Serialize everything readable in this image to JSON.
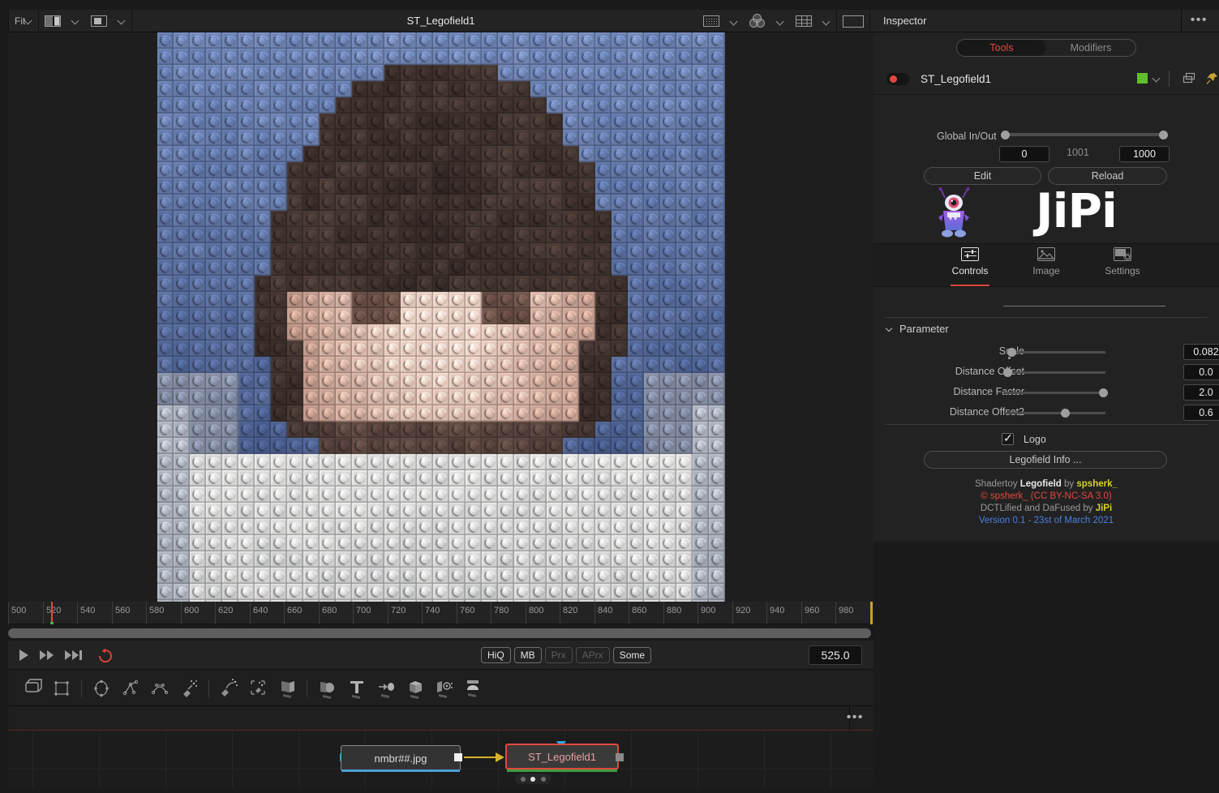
{
  "viewer": {
    "title": "ST_Legofield1",
    "toolbar": {
      "fit_label": "Fit",
      "split_view_icon": "split-view-icon",
      "inset_view_icon": "inset-view-icon",
      "roi_icon": "region-of-interest-icon",
      "color_icon": "color-channels-icon",
      "grid_icon": "grid-overlay-icon",
      "frame_icon": "frame-aspect-icon",
      "options_icon": "more-options-icon"
    }
  },
  "timeline": {
    "ticks": [
      500,
      520,
      540,
      560,
      580,
      600,
      620,
      640,
      660,
      680,
      700,
      720,
      740,
      760,
      780,
      800,
      820,
      840,
      860,
      880,
      900,
      920,
      940,
      960,
      980
    ],
    "range_start": 500,
    "range_end": 1000,
    "playhead_frame": 525
  },
  "transport": {
    "play_icon": "play-icon",
    "fast_forward_icon": "fast-forward-icon",
    "skip_end_icon": "skip-to-end-icon",
    "loop_icon": "loop-icon",
    "quality_buttons": [
      {
        "label": "HiQ",
        "active": true
      },
      {
        "label": "MB",
        "active": true
      },
      {
        "label": "Prx",
        "active": false
      },
      {
        "label": "APrx",
        "active": false
      },
      {
        "label": "Some",
        "active": true
      }
    ],
    "current_frame": "525.0"
  },
  "node_tools": [
    {
      "name": "transform-tool-icon"
    },
    {
      "name": "rectangle-mask-icon"
    },
    {
      "name": "ellipse-mask-icon"
    },
    {
      "name": "polygon-mask-icon"
    },
    {
      "name": "bspline-mask-icon"
    },
    {
      "name": "paint-tool-icon"
    },
    {
      "name": "paint-stroke-icon"
    },
    {
      "name": "paint-select-icon"
    },
    {
      "name": "merge3d-icon"
    },
    {
      "name": "shape3d-icon"
    },
    {
      "name": "text3d-icon"
    },
    {
      "name": "replicate3d-icon"
    },
    {
      "name": "cube3d-icon"
    },
    {
      "name": "camera3d-icon"
    },
    {
      "name": "renderer3d-icon"
    }
  ],
  "node_graph": {
    "source_node": "nmbr##.jpg",
    "target_node": "ST_Legofield1"
  },
  "inspector": {
    "panel_title": "Inspector",
    "more_icon": "more-options-icon",
    "segments": [
      {
        "label": "Tools",
        "active": true
      },
      {
        "label": "Modifiers",
        "active": false
      }
    ],
    "node": {
      "name": "ST_Legofield1",
      "enable_toggle": "node-enable-toggle",
      "color_swatch": "#5fbf2c",
      "color_chevron_icon": "chevron-down-icon",
      "copy_icon": "duplicate-icon",
      "pin_icon": "pin-icon",
      "lock_icon": "lock-icon",
      "reset_icon": "reset-icon"
    },
    "global_in_out": {
      "label": "Global In/Out",
      "in_value": "0",
      "mid_value": "1001",
      "out_value": "1000"
    },
    "buttons": {
      "edit": "Edit",
      "reload": "Reload"
    },
    "branding": {
      "wordmark": "JiPi",
      "mascot_icon": "alien-mascot-icon"
    },
    "tabs": [
      {
        "label": "Controls",
        "icon": "sliders-icon",
        "active": true
      },
      {
        "label": "Image",
        "icon": "image-icon",
        "active": false
      },
      {
        "label": "Settings",
        "icon": "settings-icon",
        "active": false
      }
    ],
    "parameter_group": {
      "title": "Parameter",
      "collapse_icon": "chevron-down-icon",
      "rows": [
        {
          "label": "Scale",
          "value": "0.082",
          "knob_pct": 4,
          "keyframe_icon": "keyframe-diamond-icon"
        },
        {
          "label": "Distance Offset",
          "value": "0.0",
          "knob_pct": 0,
          "keyframe_icon": "keyframe-diamond-icon"
        },
        {
          "label": "Distance Factor",
          "value": "2.0",
          "knob_pct": 100,
          "keyframe_icon": "keyframe-diamond-icon"
        },
        {
          "label": "Distance Offset2",
          "value": "0.6",
          "knob_pct": 60,
          "keyframe_icon": "keyframe-diamond-icon"
        }
      ]
    },
    "logo_checkbox": {
      "label": "Logo",
      "checked": true
    },
    "info_button": "Legofield Info ...",
    "credits": {
      "line1_a": "Shadertoy ",
      "line1_b": "Legofield",
      "line1_c": " by ",
      "line1_d": "spsherk_",
      "line2": "© spsherk_ (CC BY-NC-SA 3.0)",
      "line3_a": "DCTLified and DaFused by ",
      "line3_b": "JiPi",
      "line4": "Version 0.1 - 23st of March 2021"
    }
  },
  "colors": {
    "accent_red": "#e2483c",
    "node_green": "#3f9d3f",
    "wire_yellow": "#d7b22c",
    "connector_blue": "#29a8e8"
  }
}
